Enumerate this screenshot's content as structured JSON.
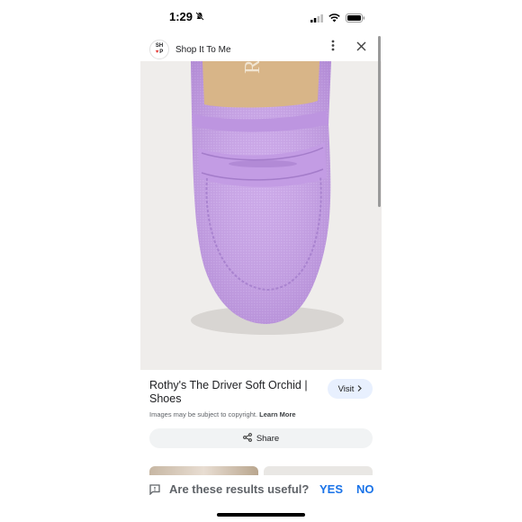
{
  "status_bar": {
    "time": "1:29",
    "icons": [
      "bell-slash-icon",
      "signal-icon",
      "wifi-icon",
      "battery-icon"
    ]
  },
  "header": {
    "logo_top": "SH",
    "logo_bottom": "P",
    "site_name": "Shop It To Me",
    "icons": [
      "more-vert-icon",
      "close-icon"
    ]
  },
  "product": {
    "title": "Rothy's The Driver Soft Orchid | Shoes",
    "visit_label": "Visit",
    "copyright_text": "Images may be subject to copyright.",
    "learn_more": "Learn More",
    "share_label": "Share",
    "image_brand_text": "R",
    "shoe_color": "#c9a4e8"
  },
  "feedback": {
    "question": "Are these results useful?",
    "yes": "YES",
    "no": "NO",
    "accent": "#1a73e8"
  }
}
